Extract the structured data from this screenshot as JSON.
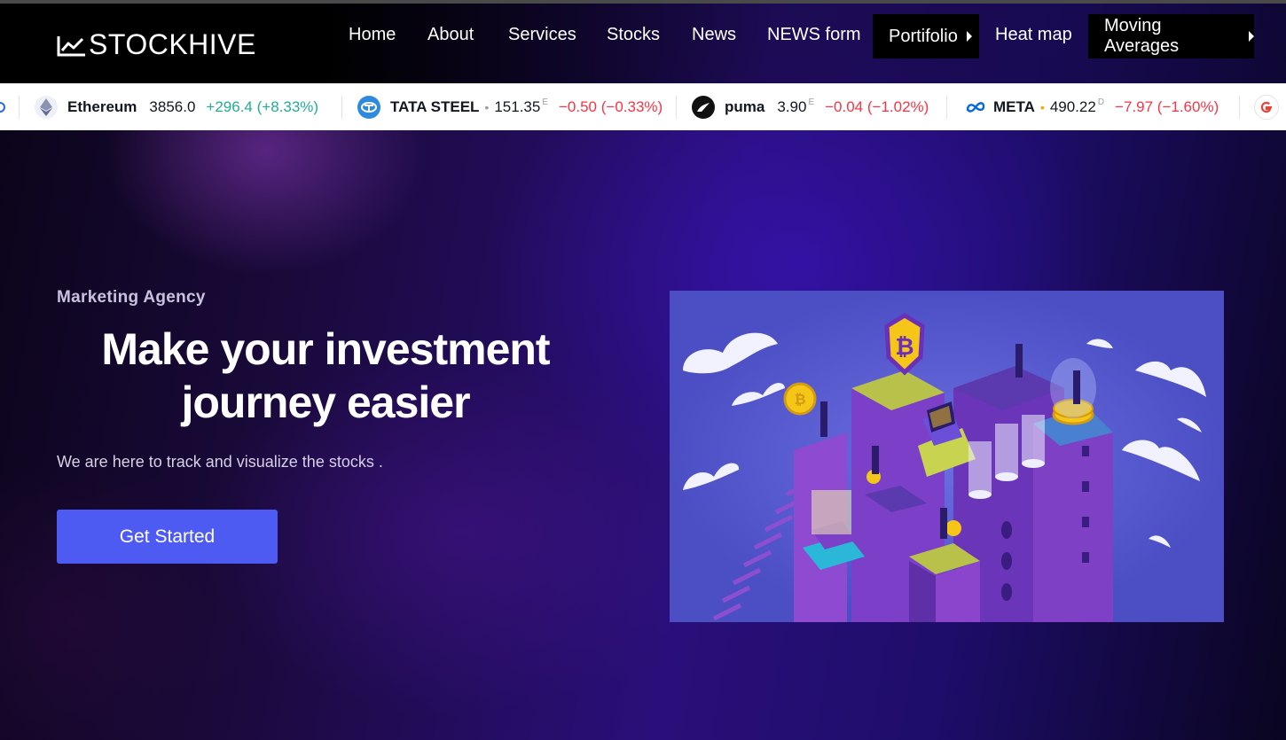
{
  "brand": {
    "name": "STOCKHIVE"
  },
  "nav": {
    "items": [
      {
        "label": "Home"
      },
      {
        "label": "About"
      },
      {
        "label": "Services"
      },
      {
        "label": "Stocks"
      },
      {
        "label": "News"
      },
      {
        "label": "NEWS form"
      },
      {
        "label": "Portifolio",
        "has_submenu": true
      },
      {
        "label": "Heat map"
      },
      {
        "label": "Moving Averages",
        "has_submenu": true
      }
    ]
  },
  "ticker": {
    "items": [
      {
        "name": "Ethereum",
        "price": "3856.0",
        "change": "+296.4 (+8.33%)",
        "direction": "up",
        "icon": "ethereum-icon"
      },
      {
        "name": "TATA STEEL",
        "price": "151.35",
        "flag": "E",
        "change": "−0.50 (−0.33%)",
        "direction": "down",
        "icon": "tata-icon"
      },
      {
        "name": "puma",
        "price": "3.90",
        "flag": "E",
        "change": "−0.04 (−1.02%)",
        "direction": "down",
        "icon": "puma-icon"
      },
      {
        "name": "META",
        "price": "490.22",
        "flag": "D",
        "change": "−7.97 (−1.60%)",
        "direction": "down",
        "icon": "meta-icon"
      }
    ],
    "colors": {
      "up": "#22ab94",
      "down": "#f23645"
    }
  },
  "hero": {
    "eyebrow": "Marketing Agency",
    "headline_line1": "Make your investment",
    "headline_line2": "journey easier",
    "subtitle": "We are here to track and visualize the stocks .",
    "cta_label": "Get Started",
    "illustration": "crypto-isometric-illustration"
  },
  "colors": {
    "accent": "#4e5bf2",
    "illustration_bg": "#4c4fc4",
    "coin": "#f5c518"
  }
}
